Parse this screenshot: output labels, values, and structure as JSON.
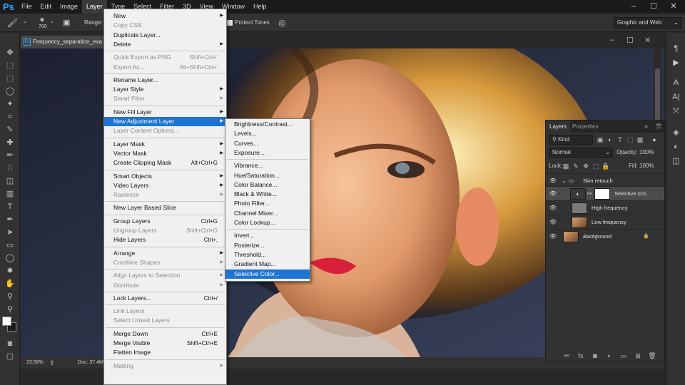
{
  "app": {
    "logo": "Ps"
  },
  "menubar": {
    "items": [
      "File",
      "Edit",
      "Image",
      "Layer",
      "Type",
      "Select",
      "Filter",
      "3D",
      "View",
      "Window",
      "Help"
    ],
    "active": "Layer"
  },
  "options": {
    "brush_size": "700",
    "range_label": "Range:",
    "protect_tones": "Protect Tones",
    "workspace": "Graphic and Web"
  },
  "document": {
    "tab_title": "Frequency_separation_exa",
    "zoom": "23.58%",
    "doc_size": "Doc: 37.4M"
  },
  "layer_menu": {
    "items": [
      {
        "label": "New",
        "submenu": true,
        "disabled": false
      },
      {
        "label": "Copy CSS",
        "disabled": true
      },
      {
        "label": "Duplicate Layer...",
        "disabled": false
      },
      {
        "label": "Delete",
        "submenu": true,
        "disabled": false
      },
      {
        "sep": true
      },
      {
        "label": "Quick Export as PNG",
        "shortcut": "Shift+Ctrl+'",
        "disabled": true
      },
      {
        "label": "Export As...",
        "shortcut": "Alt+Shift+Ctrl+'",
        "disabled": true
      },
      {
        "sep": true
      },
      {
        "label": "Rename Layer...",
        "disabled": false
      },
      {
        "label": "Layer Style",
        "submenu": true,
        "disabled": false
      },
      {
        "label": "Smart Filter",
        "submenu": true,
        "disabled": true
      },
      {
        "sep": true
      },
      {
        "label": "New Fill Layer",
        "submenu": true,
        "disabled": false
      },
      {
        "label": "New Adjustment Layer",
        "submenu": true,
        "highlight": true
      },
      {
        "label": "Layer Content Options...",
        "disabled": true
      },
      {
        "sep": true
      },
      {
        "label": "Layer Mask",
        "submenu": true,
        "disabled": false
      },
      {
        "label": "Vector Mask",
        "submenu": true,
        "disabled": false
      },
      {
        "label": "Create Clipping Mask",
        "shortcut": "Alt+Ctrl+G",
        "disabled": false
      },
      {
        "sep": true
      },
      {
        "label": "Smart Objects",
        "submenu": true,
        "disabled": false
      },
      {
        "label": "Video Layers",
        "submenu": true,
        "disabled": false
      },
      {
        "label": "Rasterize",
        "submenu": true,
        "disabled": true
      },
      {
        "sep": true
      },
      {
        "label": "New Layer Based Slice",
        "disabled": false
      },
      {
        "sep": true
      },
      {
        "label": "Group Layers",
        "shortcut": "Ctrl+G",
        "disabled": false
      },
      {
        "label": "Ungroup Layers",
        "shortcut": "Shift+Ctrl+G",
        "disabled": true
      },
      {
        "label": "Hide Layers",
        "shortcut": "Ctrl+,",
        "disabled": false
      },
      {
        "sep": true
      },
      {
        "label": "Arrange",
        "submenu": true,
        "disabled": false
      },
      {
        "label": "Combine Shapes",
        "submenu": true,
        "disabled": true
      },
      {
        "sep": true
      },
      {
        "label": "Align Layers to Selection",
        "submenu": true,
        "disabled": true
      },
      {
        "label": "Distribute",
        "submenu": true,
        "disabled": true
      },
      {
        "sep": true
      },
      {
        "label": "Lock Layers...",
        "shortcut": "Ctrl+/",
        "disabled": false
      },
      {
        "sep": true
      },
      {
        "label": "Link Layers",
        "disabled": true
      },
      {
        "label": "Select Linked Layers",
        "disabled": true
      },
      {
        "sep": true
      },
      {
        "label": "Merge Down",
        "shortcut": "Ctrl+E",
        "disabled": false
      },
      {
        "label": "Merge Visible",
        "shortcut": "Shift+Ctrl+E",
        "disabled": false
      },
      {
        "label": "Flatten Image",
        "disabled": false
      },
      {
        "sep": true
      },
      {
        "label": "Matting",
        "submenu": true,
        "disabled": true
      }
    ]
  },
  "adjustment_submenu": {
    "items": [
      {
        "label": "Brightness/Contrast..."
      },
      {
        "label": "Levels..."
      },
      {
        "label": "Curves..."
      },
      {
        "label": "Exposure..."
      },
      {
        "sep": true
      },
      {
        "label": "Vibrance..."
      },
      {
        "label": "Hue/Saturation..."
      },
      {
        "label": "Color Balance..."
      },
      {
        "label": "Black & White..."
      },
      {
        "label": "Photo Filter..."
      },
      {
        "label": "Channel Mixer..."
      },
      {
        "label": "Color Lookup..."
      },
      {
        "sep": true
      },
      {
        "label": "Invert..."
      },
      {
        "label": "Posterize..."
      },
      {
        "label": "Threshold..."
      },
      {
        "label": "Gradient Map..."
      },
      {
        "label": "Selective Color...",
        "highlight": true
      }
    ]
  },
  "layers_panel": {
    "tabs": [
      "Layers",
      "Properties"
    ],
    "active_tab": "Layers",
    "filter_kind": "Kind",
    "blend_mode": "Normal",
    "opacity_label": "Opacity:",
    "opacity": "100%",
    "lock_label": "Lock:",
    "fill_label": "Fill:",
    "fill": "100%",
    "layers": [
      {
        "name": "Skin retouch",
        "type": "group"
      },
      {
        "name": "Selective Col...",
        "type": "adjustment",
        "selected": true
      },
      {
        "name": "High frequency",
        "type": "gray"
      },
      {
        "name": "Low frequency",
        "type": "photo"
      },
      {
        "name": "Background",
        "type": "photo",
        "italic": true,
        "locked": true
      }
    ]
  },
  "colors": {
    "menu_highlight": "#1c74d4",
    "ps_blue": "#31a8ff",
    "panel_bg": "#323232"
  }
}
